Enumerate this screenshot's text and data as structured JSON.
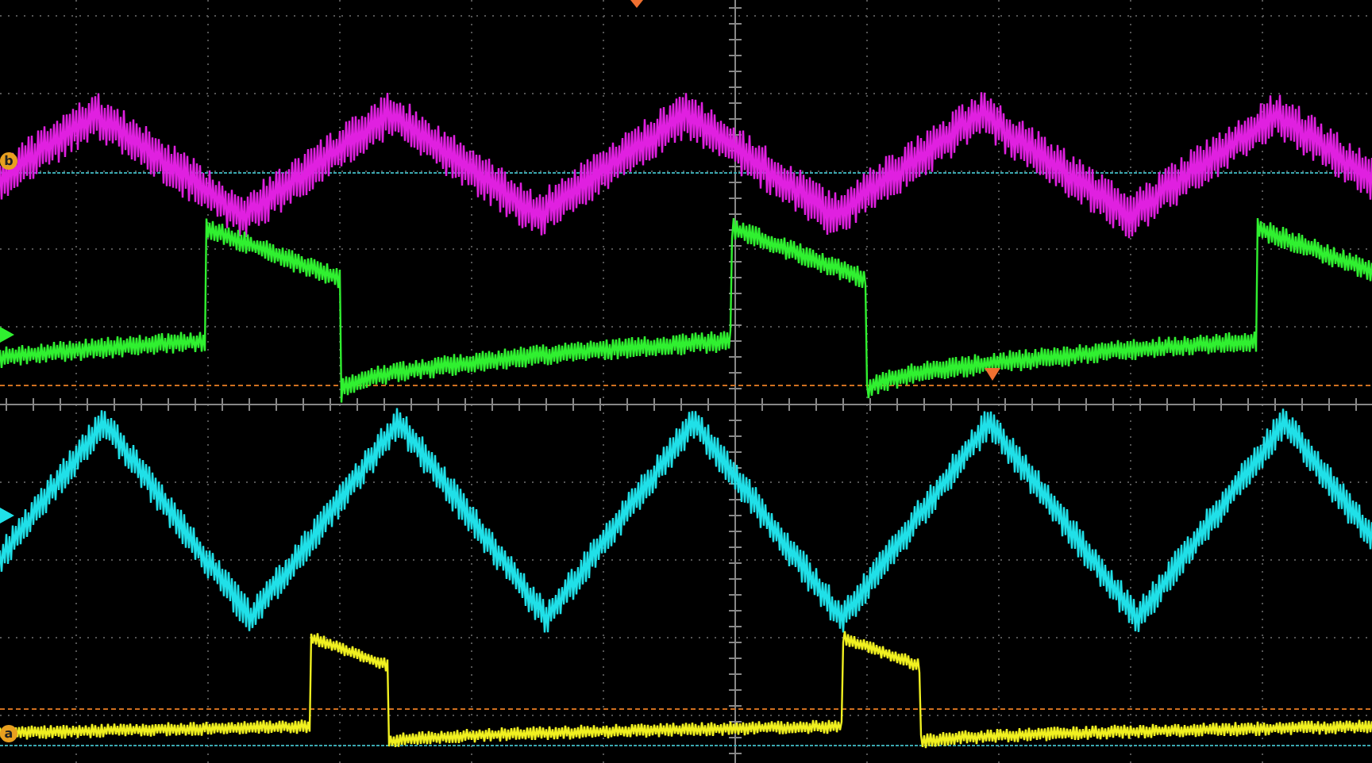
{
  "screen": {
    "kind": "oscilloscope"
  },
  "channels": [
    {
      "kind": "triangle",
      "color": "#e020e0",
      "marker": {
        "kind": "letter",
        "label": "b"
      }
    },
    {
      "kind": "ramp",
      "color": "#30f030",
      "marker": {
        "kind": "arrow"
      }
    },
    {
      "kind": "triangle",
      "color": "#20e0e8",
      "marker": {
        "kind": "arrow"
      }
    },
    {
      "kind": "pulse",
      "color": "#f0f020",
      "marker": {
        "kind": "letter",
        "label": "a"
      }
    }
  ]
}
